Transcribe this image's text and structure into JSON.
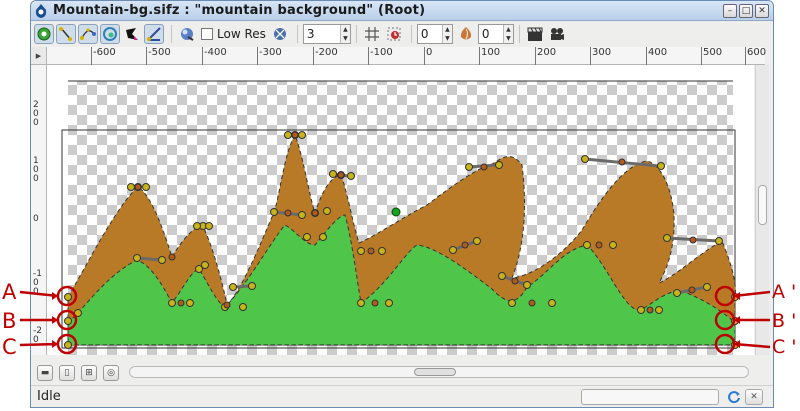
{
  "window": {
    "title": "Mountain-bg.sifz : \"mountain background\" (Root)",
    "controls": {
      "minimize": "–",
      "maximize": "□",
      "close": "✕"
    }
  },
  "toolbar": {
    "low_res_label": "Low Res",
    "spin_a": "3",
    "spin_b": "0",
    "spin_c": "0",
    "icons": [
      "circle-tool-icon",
      "transform-tool-icon",
      "spline-tool-icon",
      "smooth-move-icon",
      "fill-tool-icon",
      "mirror-tool-icon",
      "render-icon",
      "preview-icon",
      "grid-icon",
      "onion-skin-icon",
      "keyframe-lock-icon",
      "clapperboard-icon",
      "camera-icon"
    ]
  },
  "ruler": {
    "horizontal_labels": [
      "-600",
      "-500",
      "-400",
      "-300",
      "-200",
      "-100",
      "0",
      "100",
      "200",
      "300",
      "400",
      "500",
      "600"
    ],
    "vertical_labels": [
      "2\n0\n0",
      "1\n0\n0",
      "0",
      "-1\n0\n0",
      "-2\n0"
    ]
  },
  "status": {
    "text": "Idle"
  },
  "annotations": {
    "left": [
      "A",
      "B",
      "C"
    ],
    "right": [
      "A '",
      "B '",
      "C '"
    ]
  },
  "colors": {
    "brown_layer": "#b87a26",
    "green_layer": "#4fc64a",
    "handle_fill": "#c8b41a",
    "annotation": "#c00000"
  }
}
